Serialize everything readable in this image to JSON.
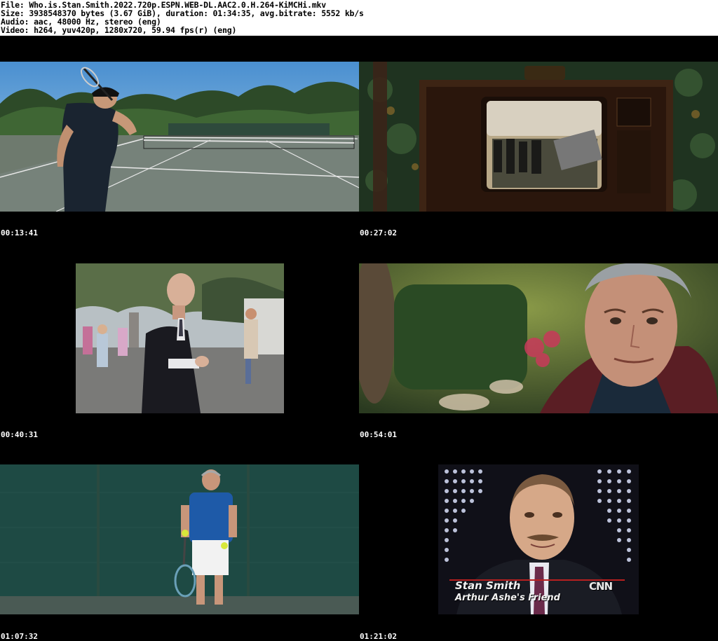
{
  "header": {
    "file_line": "File: Who.is.Stan.Smith.2022.720p.ESPN.WEB-DL.AAC2.0.H.264-KiMCHi.mkv",
    "size_line": "Size: 3938548370 bytes (3.67 GiB), duration: 01:34:35, avg.bitrate: 5552 kb/s",
    "audio_line": "Audio: aac, 48000 Hz, stereo (eng)",
    "video_line": "Video: h264, yuv420p, 1280x720, 59.94 fps(r) (eng)"
  },
  "thumbnails": [
    {
      "timestamp": "00:13:41",
      "scene": "tennis-court-player"
    },
    {
      "timestamp": "00:27:02",
      "scene": "vintage-tv-set"
    },
    {
      "timestamp": "00:40:31",
      "scene": "man-in-suit-crowd"
    },
    {
      "timestamp": "00:54:01",
      "scene": "elderly-man-closeup"
    },
    {
      "timestamp": "01:07:32",
      "scene": "player-with-tennis-balls"
    },
    {
      "timestamp": "01:21:02",
      "scene": "cnn-interview"
    }
  ],
  "cnn_caption": {
    "name": "Stan Smith",
    "subtitle": "Arthur Ashe's Friend",
    "network_logo": "CNN"
  }
}
